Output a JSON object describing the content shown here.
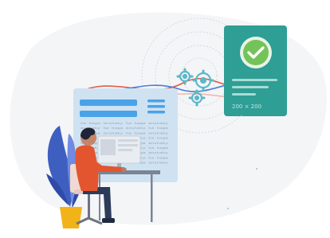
{
  "illustration": {
    "status_card": {
      "size_text": "200 × 200",
      "icon": "checkmark-icon",
      "accent": "#2f9e94",
      "check_color": "#74c35a"
    },
    "document_panel": {
      "code_rows": [
        "ha hoga  anshaky  ha hoga  anshaky",
        "anshaky  ha hoga  anshaky  ha hoga",
        "ha hoga  anshaky  ha hoga  anshaky",
        "anshaky  ha hoga  anshaky  ha hoga",
        "ha hoga  anshaky  ha hoga  anshaky",
        "anshaky  ha hoga  anshaky  ha hoga",
        "ha hoga  anshaky  ha hoga  anshaky",
        "anshaky  ha hoga  anshaky  ha hoga",
        "ha hoga  anshaky  ha hoga  anshaky"
      ],
      "accent": "#4aa3e8"
    },
    "gears": {
      "icon": "gears-icon",
      "color": "#5bb8c9"
    },
    "wave_colors": [
      "#e05c4b",
      "#4a7fd4",
      "#f0b9ae"
    ],
    "plant": {
      "icon": "plant-icon",
      "leaf_color": "#3f5fc0",
      "pot_color": "#f2b318"
    },
    "person": {
      "icon": "person-icon",
      "shirt_color": "#e2552f"
    }
  }
}
